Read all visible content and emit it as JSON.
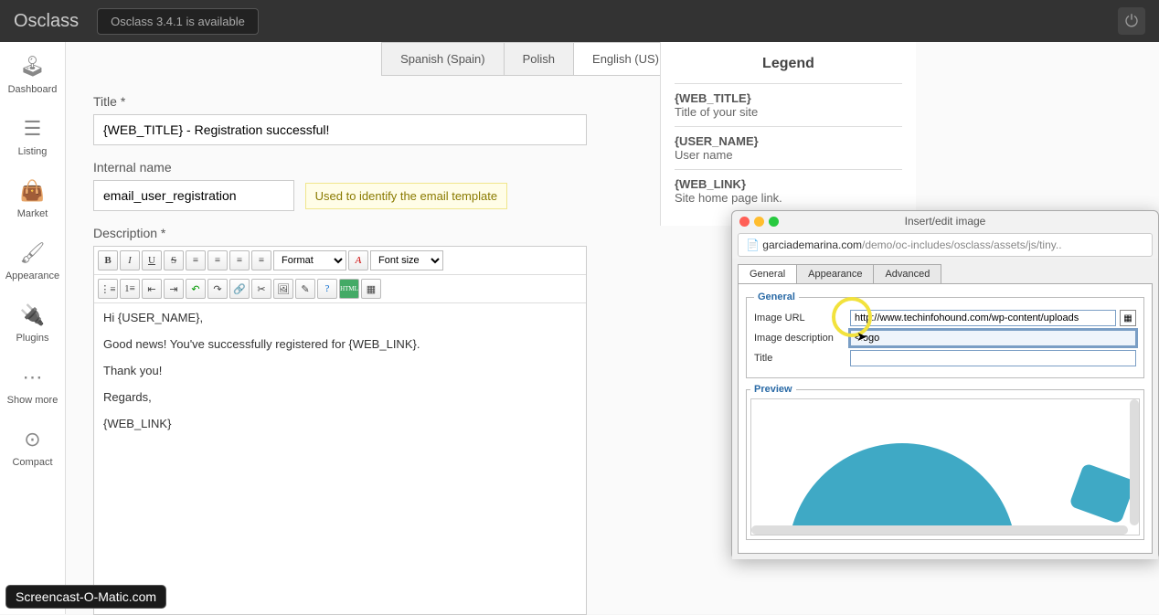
{
  "topbar": {
    "brand": "Osclass",
    "update": "Osclass 3.4.1 is available"
  },
  "sidebar": {
    "items": [
      {
        "label": "Dashboard",
        "icon": "🕹"
      },
      {
        "label": "Listing",
        "icon": "≡"
      },
      {
        "label": "Market",
        "icon": "👜"
      },
      {
        "label": "Appearance",
        "icon": "🖌"
      },
      {
        "label": "Plugins",
        "icon": "🔌"
      },
      {
        "label": "Show more",
        "icon": "⋯"
      },
      {
        "label": "Compact",
        "icon": "⊙"
      }
    ]
  },
  "tabs": {
    "items": [
      "Spanish (Spain)",
      "Polish",
      "English (US)"
    ],
    "active": 2
  },
  "form": {
    "title_label": "Title *",
    "title_value": "{WEB_TITLE} - Registration successful!",
    "internal_label": "Internal name",
    "internal_value": "email_user_registration",
    "internal_hint": "Used to identify the email template",
    "desc_label": "Description *",
    "format_label": "Format",
    "fontsize_label": "Font size",
    "body": {
      "l1": "Hi {USER_NAME},",
      "l2": "Good news! You've successfully registered for {WEB_LINK}.",
      "l3": "Thank you!",
      "l4": "Regards,",
      "l5": "{WEB_LINK}"
    }
  },
  "legend": {
    "title": "Legend",
    "items": [
      {
        "k": "{WEB_TITLE}",
        "d": "Title of your site"
      },
      {
        "k": "{USER_NAME}",
        "d": "User name"
      },
      {
        "k": "{WEB_LINK}",
        "d": "Site home page link."
      }
    ]
  },
  "popup": {
    "window_title": "Insert/edit image",
    "url_host": "garciademarina.com",
    "url_path": "/demo/oc-includes/osclass/assets/js/tiny..",
    "tabs": [
      "General",
      "Appearance",
      "Advanced"
    ],
    "fieldset_general": "General",
    "fieldset_preview": "Preview",
    "image_url_label": "Image URL",
    "image_url_value": "http://www.techinfohound.com/wp-content/uploads",
    "image_desc_label": "Image description",
    "image_desc_value": "<logo",
    "title_label": "Title",
    "title_value": ""
  },
  "watermark": "Screencast-O-Matic.com"
}
